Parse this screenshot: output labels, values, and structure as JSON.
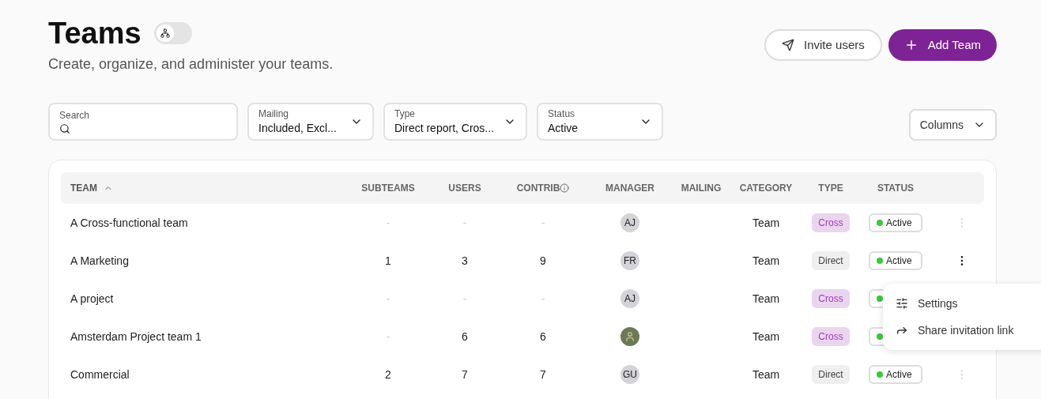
{
  "header": {
    "title": "Teams",
    "hierarchy_toggle": {
      "on": false
    },
    "subtitle": "Create, organize, and administer your teams.",
    "buttons": [
      {
        "kind": "secondary",
        "label": "Invite users"
      },
      {
        "kind": "primary",
        "label": "Add Team"
      }
    ]
  },
  "filters": [
    {
      "kind": "search",
      "label": "Search"
    },
    {
      "kind": "select",
      "label": "Mailing",
      "value": "Included, Excl..."
    },
    {
      "kind": "select",
      "label": "Type",
      "value": "Direct report, Cros..."
    },
    {
      "kind": "select",
      "label": "Status",
      "value": "Active"
    }
  ],
  "columns_button": "Columns",
  "table": {
    "columns": [
      {
        "label": "TEAM",
        "sorted": true
      },
      {
        "label": "SUBTEAMS",
        "sorted": false
      },
      {
        "label": "USERS",
        "sorted": false
      },
      {
        "label": "CONTRIB",
        "sorted": false,
        "info": true
      },
      {
        "label": "MANAGER",
        "sorted": false
      },
      {
        "label": "MAILING",
        "sorted": false
      },
      {
        "label": "CATEGORY",
        "sorted": false
      },
      {
        "label": "TYPE",
        "sorted": false
      },
      {
        "label": "STATUS",
        "sorted": false
      }
    ],
    "rows": [
      {
        "team": "A Cross-functional team",
        "subteams": "-",
        "users": "-",
        "contrib": "-",
        "manager": {
          "kind": "initials",
          "initials": "AJ"
        },
        "category": "Team",
        "type": {
          "kind": "cross",
          "label": "Cross"
        },
        "status": {
          "label": "Active",
          "color": "#3ac93a"
        },
        "menu_open": false
      },
      {
        "team": "A Marketing",
        "subteams": "1",
        "users": "3",
        "contrib": "9",
        "manager": {
          "kind": "initials",
          "initials": "FR"
        },
        "category": "Team",
        "type": {
          "kind": "direct",
          "label": "Direct"
        },
        "status": {
          "label": "Active",
          "color": "#3ac93a"
        },
        "menu_open": true
      },
      {
        "team": "A project",
        "subteams": "-",
        "users": "-",
        "contrib": "-",
        "manager": {
          "kind": "initials",
          "initials": "AJ"
        },
        "category": "Team",
        "type": {
          "kind": "cross",
          "label": "Cross"
        },
        "status": {
          "color": "#3ac93a"
        }
      },
      {
        "team": "Amsterdam Project team 1",
        "subteams": "-",
        "users": "6",
        "contrib": "6",
        "manager": {
          "kind": "photo"
        },
        "category": "Team",
        "type": {
          "kind": "cross",
          "label": "Cross"
        },
        "status": {
          "color": "#3ac93a"
        }
      },
      {
        "team": "Commercial",
        "subteams": "2",
        "users": "7",
        "contrib": "7",
        "manager": {
          "kind": "initials",
          "initials": "GU"
        },
        "category": "Team",
        "type": {
          "kind": "direct",
          "label": "Direct"
        },
        "status": {
          "label": "Active",
          "color": "#3ac93a"
        },
        "menu_open": false
      }
    ]
  },
  "row_menu": {
    "items": [
      {
        "kind": "settings",
        "label": "Settings"
      },
      {
        "kind": "share",
        "label": "Share invitation link"
      }
    ]
  }
}
